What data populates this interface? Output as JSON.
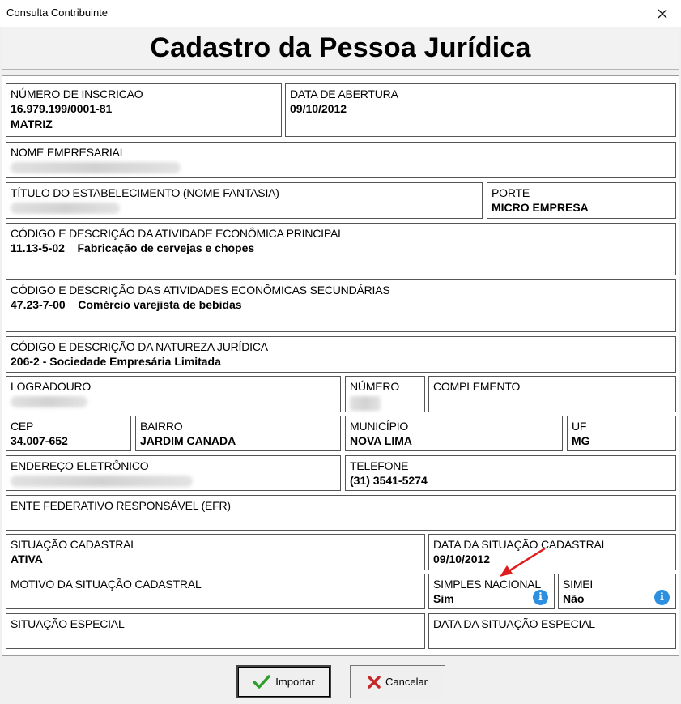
{
  "window": {
    "title": "Consulta Contribuinte"
  },
  "header": {
    "title": "Cadastro da Pessoa Jurídica"
  },
  "fields": {
    "inscricao": {
      "label": "NÚMERO DE INSCRICAO",
      "value": "16.979.199/0001-81",
      "value2": "MATRIZ"
    },
    "abertura": {
      "label": "DATA DE ABERTURA",
      "value": "09/10/2012"
    },
    "nome_empresarial": {
      "label": "NOME EMPRESARIAL"
    },
    "titulo": {
      "label": "TÍTULO DO ESTABELECIMENTO (NOME FANTASIA)"
    },
    "porte": {
      "label": "PORTE",
      "value": "MICRO EMPRESA"
    },
    "atividade_principal": {
      "label": "CÓDIGO E DESCRIÇÃO DA ATIVIDADE ECONÔMICA PRINCIPAL",
      "value": "11.13-5-02    Fabricação de cervejas e chopes"
    },
    "atividades_secundarias": {
      "label": "CÓDIGO E DESCRIÇÃO DAS ATIVIDADES ECONÔMICAS SECUNDÁRIAS",
      "value": "47.23-7-00    Comércio varejista de bebidas"
    },
    "natureza": {
      "label": "CÓDIGO E DESCRIÇÃO DA NATUREZA JURÍDICA",
      "value": "206-2 - Sociedade Empresária Limitada"
    },
    "logradouro": {
      "label": "LOGRADOURO"
    },
    "numero": {
      "label": "NÚMERO"
    },
    "complemento": {
      "label": "COMPLEMENTO"
    },
    "cep": {
      "label": "CEP",
      "value": "34.007-652"
    },
    "bairro": {
      "label": "BAIRRO",
      "value": "JARDIM CANADA"
    },
    "municipio": {
      "label": "MUNICÍPIO",
      "value": "NOVA LIMA"
    },
    "uf": {
      "label": "UF",
      "value": "MG"
    },
    "email": {
      "label": "ENDEREÇO ELETRÔNICO"
    },
    "telefone": {
      "label": "TELEFONE",
      "value": "(31) 3541-5274"
    },
    "efr": {
      "label": "ENTE FEDERATIVO RESPONSÁVEL (EFR)"
    },
    "situacao": {
      "label": "SITUAÇÃO CADASTRAL",
      "value": "ATIVA"
    },
    "data_situacao": {
      "label": "DATA DA SITUAÇÃO CADASTRAL",
      "value": "09/10/2012"
    },
    "motivo": {
      "label": "MOTIVO DA SITUAÇÃO CADASTRAL"
    },
    "simples": {
      "label": "SIMPLES NACIONAL",
      "value": "Sim"
    },
    "simei": {
      "label": "SIMEI",
      "value": "Não"
    },
    "situacao_especial": {
      "label": "SITUAÇÃO ESPECIAL"
    },
    "data_situacao_especial": {
      "label": "DATA DA SITUAÇÃO ESPECIAL"
    }
  },
  "icons": {
    "info": "info-icon",
    "close": "close-icon",
    "confirm": "checkmark-icon",
    "cancel": "x-icon"
  },
  "buttons": {
    "importar": "Importar",
    "cancelar": "Cancelar"
  },
  "colors": {
    "check": "#2e9e2e",
    "cancel": "#c62828",
    "info": "#2d8fe0",
    "arrow": "#e01b1b"
  }
}
